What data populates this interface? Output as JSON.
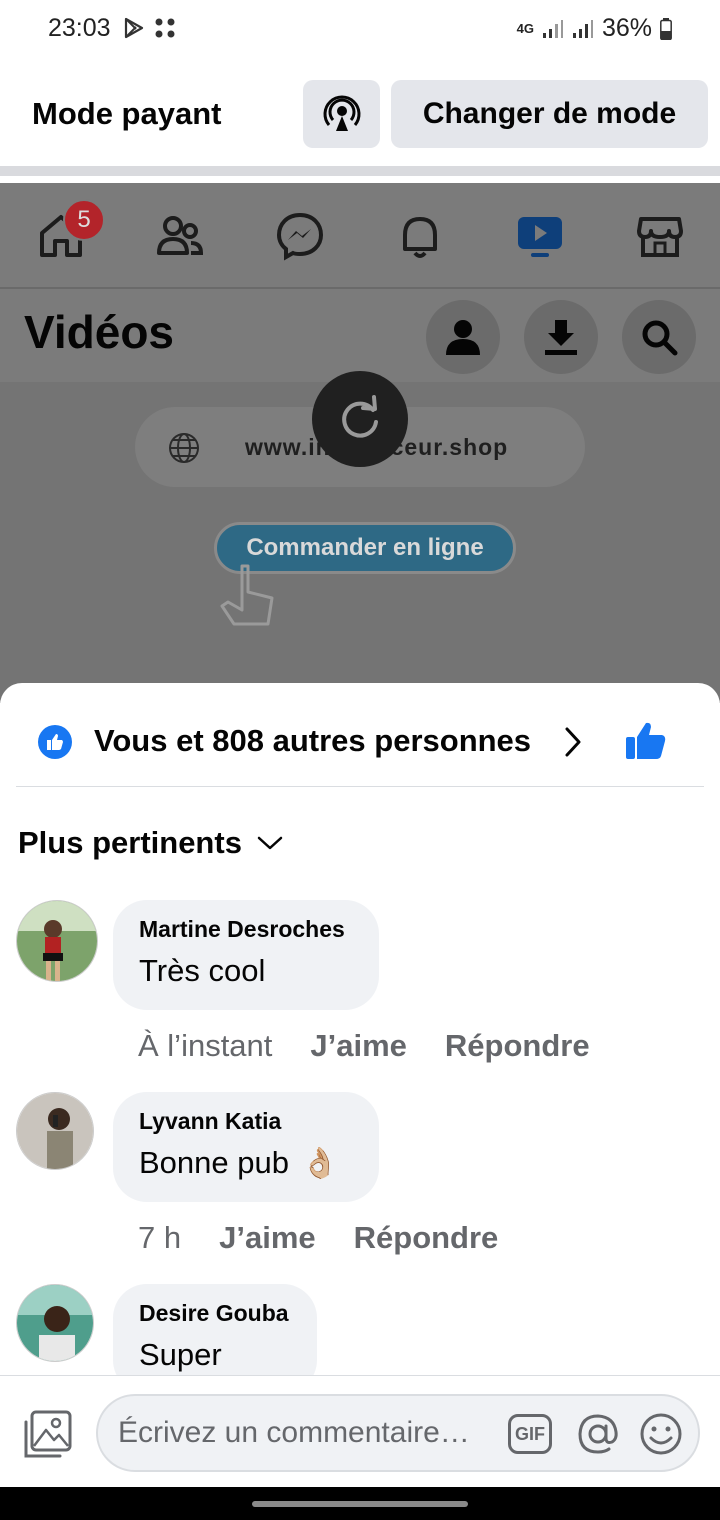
{
  "status_bar": {
    "time": "23:03",
    "network": "4G",
    "battery": "36%"
  },
  "mode_bar": {
    "title": "Mode payant",
    "live_icon": "live-broadcast-icon",
    "switch_button": "Changer de mode"
  },
  "background_app": {
    "home_badge": "5",
    "nav_icons": [
      "home-icon",
      "friends-icon",
      "messenger-icon",
      "bell-icon",
      "video-icon",
      "marketplace-icon"
    ],
    "section_title": "Vidéos",
    "video": {
      "url_text": "www.influenceur.shop",
      "order_button": "Commander en ligne"
    }
  },
  "reactions": {
    "summary": "Vous et 808 autres personnes"
  },
  "sort": {
    "label": "Plus pertinents"
  },
  "comments": [
    {
      "author": "Martine Desroches",
      "text": "Très cool",
      "time": "À l’instant",
      "like": "J’aime",
      "reply": "Répondre"
    },
    {
      "author": "Lyvann Katia",
      "text": "Bonne pub",
      "emoji": "👌🏼",
      "time": "7 h",
      "like": "J’aime",
      "reply": "Répondre"
    },
    {
      "author": "Desire Gouba",
      "text": "Super"
    }
  ],
  "composer": {
    "placeholder": "Écrivez un commentaire…",
    "gif_label": "GIF"
  },
  "colors": {
    "accent": "#1877f2",
    "badge": "#e41e3f",
    "bubble": "#f0f2f5",
    "muted": "#65676b"
  }
}
